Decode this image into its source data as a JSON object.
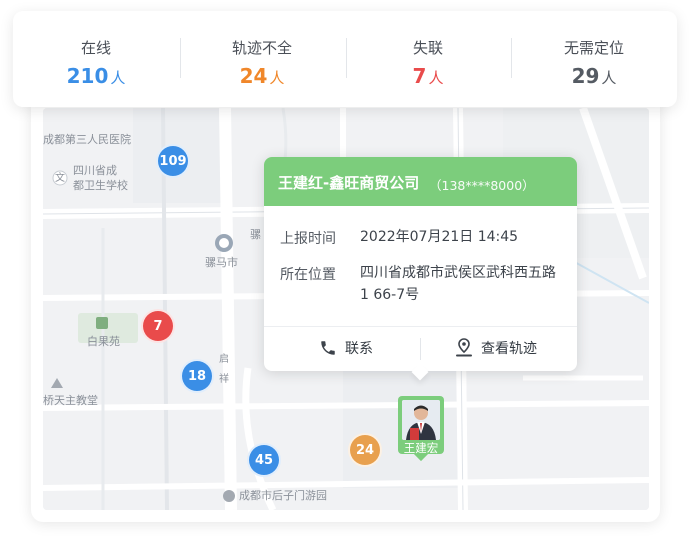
{
  "stats": [
    {
      "title": "在线",
      "value": "210",
      "unit": "人",
      "color": "#3a8ee6"
    },
    {
      "title": "轨迹不全",
      "value": "24",
      "unit": "人",
      "color": "#f0872a"
    },
    {
      "title": "失联",
      "value": "7",
      "unit": "人",
      "color": "#e94b4b"
    },
    {
      "title": "无需定位",
      "value": "29",
      "unit": "人",
      "color": "#555b63"
    }
  ],
  "map": {
    "labels": {
      "hospital": "成都第三人民医院",
      "school_line1": "四川省成",
      "school_line2": "都卫生学校",
      "wen": "文",
      "station_partial": "骡",
      "station": "骡马市",
      "park": "白果苑",
      "church": "桥天主教堂",
      "gate_park": "成都市后子门游园",
      "road_partial_1": "启",
      "road_partial_2": "祥"
    },
    "clusters": [
      {
        "count": "109",
        "color": "#3a8ee6"
      },
      {
        "count": "7",
        "color": "#e94b4b"
      },
      {
        "count": "18",
        "color": "#3a8ee6"
      },
      {
        "count": "45",
        "color": "#3a8ee6"
      },
      {
        "count": "24",
        "color": "#e8a04e"
      }
    ]
  },
  "popup": {
    "name": "王建红-鑫旺商贸公司",
    "phone": "（138****8000）",
    "report_time_label": "上报时间",
    "report_time": "2022年07月21日 14:45",
    "location_label": "所在位置",
    "location": "四川省成都市武侯区武科西五路1 66-7号",
    "contact_button": "联系",
    "track_button": "查看轨迹",
    "header_color": "#7ccd7c"
  },
  "marker": {
    "name": "王建宏"
  }
}
